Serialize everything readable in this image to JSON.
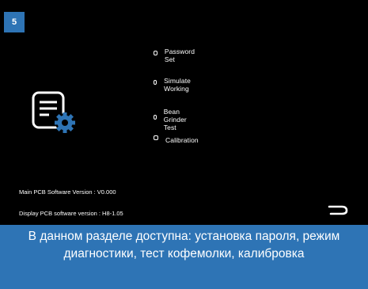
{
  "step_number": "5",
  "menu": {
    "items": [
      {
        "label": "Password Set"
      },
      {
        "label": "Simulate Working"
      },
      {
        "label": "Bean Grinder Test"
      },
      {
        "label": "Calibration"
      }
    ]
  },
  "versions": {
    "main": "Main PCB Software Version : V0.000",
    "display": "Display PCB software version : H8-1.05"
  },
  "icons": {
    "settings": "document-gear-icon",
    "back": "return-arrow-icon",
    "bullet": "square-bullet-icon"
  },
  "caption": "В данном разделе доступна: установка пароля, режим диагностики, тест кофемолки, калибровка",
  "colors": {
    "screen_bg": "#000000",
    "accent": "#2e74b5",
    "text": "#ffffff"
  }
}
